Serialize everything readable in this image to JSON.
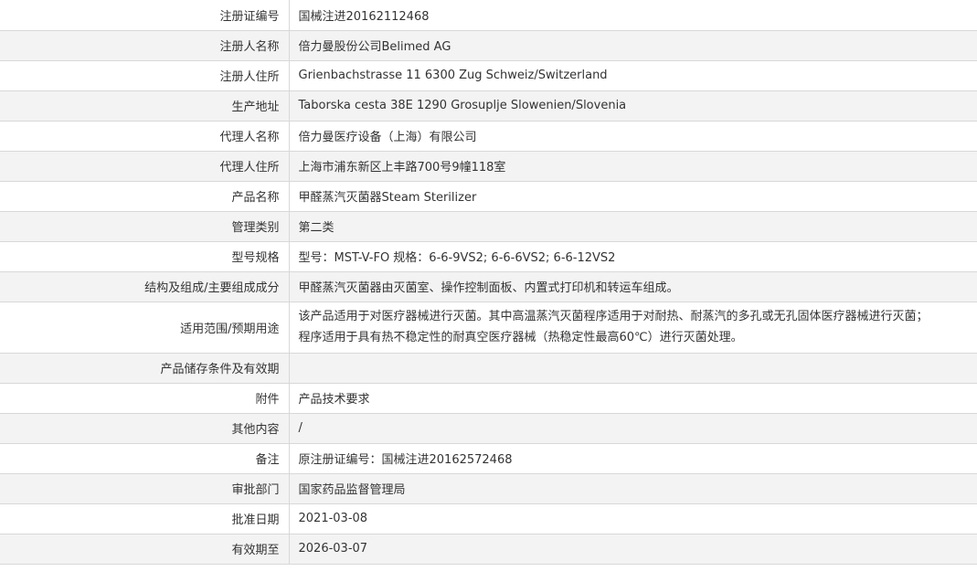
{
  "rows": [
    {
      "label": "注册证编号",
      "value": "国械注进20162112468"
    },
    {
      "label": "注册人名称",
      "value": "倍力曼股份公司Belimed AG"
    },
    {
      "label": "注册人住所",
      "value": "Grienbachstrasse 11 6300 Zug Schweiz/Switzerland"
    },
    {
      "label": "生产地址",
      "value": "Taborska cesta 38E 1290 Grosuplje Slowenien/Slovenia"
    },
    {
      "label": "代理人名称",
      "value": "倍力曼医疗设备（上海）有限公司"
    },
    {
      "label": "代理人住所",
      "value": "上海市浦东新区上丰路700号9幢118室"
    },
    {
      "label": "产品名称",
      "value": "甲醛蒸汽灭菌器Steam Sterilizer"
    },
    {
      "label": "管理类别",
      "value": "第二类"
    },
    {
      "label": "型号规格",
      "value": "型号：MST-V-FO 规格：6-6-9VS2; 6-6-6VS2; 6-6-12VS2"
    },
    {
      "label": "结构及组成/主要组成成分",
      "value": "甲醛蒸汽灭菌器由灭菌室、操作控制面板、内置式打印机和转运车组成。"
    },
    {
      "label": "适用范围/预期用途",
      "value_lines": [
        "该产品适用于对医疗器械进行灭菌。其中高温蒸汽灭菌程序适用于对耐热、耐蒸汽的多孔或无孔固体医疗器械进行灭菌；",
        "程序适用于具有热不稳定性的耐真空医疗器械（热稳定性最高60℃）进行灭菌处理。"
      ]
    },
    {
      "label": "产品储存条件及有效期",
      "value": ""
    },
    {
      "label": "附件",
      "value": "产品技术要求"
    },
    {
      "label": "其他内容",
      "value": "/"
    },
    {
      "label": "备注",
      "value": "原注册证编号：国械注进20162572468"
    },
    {
      "label": "审批部门",
      "value": "国家药品监督管理局"
    },
    {
      "label": "批准日期",
      "value": "2021-03-08"
    },
    {
      "label": "有效期至",
      "value": "2026-03-07"
    }
  ]
}
